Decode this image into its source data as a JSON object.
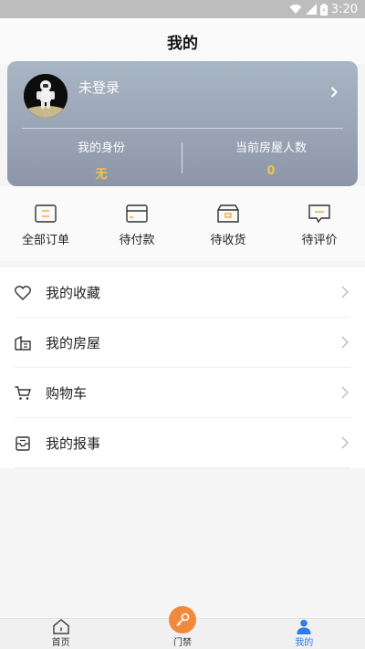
{
  "status_bar": {
    "time": "3:20"
  },
  "header": {
    "title": "我的"
  },
  "profile": {
    "login_text": "未登录",
    "identity_label": "我的身份",
    "identity_value": "无",
    "residents_label": "当前房屋人数",
    "residents_value": "0"
  },
  "orders": [
    {
      "label": "全部订单",
      "icon": "order-list-icon"
    },
    {
      "label": "待付款",
      "icon": "card-icon"
    },
    {
      "label": "待收货",
      "icon": "box-icon"
    },
    {
      "label": "待评价",
      "icon": "comment-icon"
    }
  ],
  "menu": [
    {
      "label": "我的收藏",
      "icon": "heart-icon"
    },
    {
      "label": "我的房屋",
      "icon": "building-icon"
    },
    {
      "label": "购物车",
      "icon": "cart-icon"
    },
    {
      "label": "我的报事",
      "icon": "inbox-icon"
    }
  ],
  "tabbar": {
    "home_label": "首页",
    "access_label": "门禁",
    "mine_label": "我的"
  },
  "colors": {
    "accent_orange": "#f08a3a",
    "active_blue": "#2f7be8",
    "stat_yellow": "#f5c342",
    "icon_orange": "#f3a73b"
  }
}
